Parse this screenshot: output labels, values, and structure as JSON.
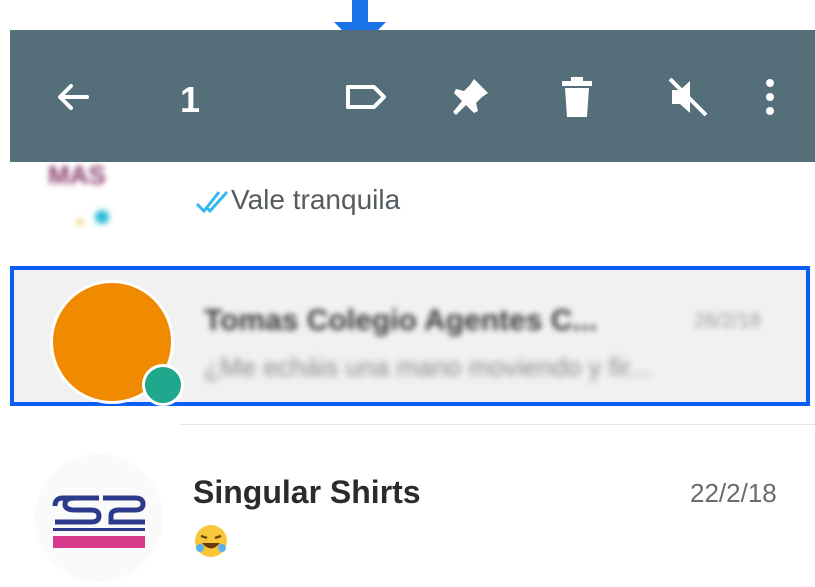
{
  "toolbar": {
    "selected_count": "1",
    "icons": [
      "back-arrow-icon",
      "label-icon",
      "pin-icon",
      "delete-icon",
      "mute-icon",
      "more-vert-icon"
    ]
  },
  "chats": [
    {
      "last_message": "Vale tranquila",
      "status": "double-check-read"
    },
    {
      "name": "Tomas Colegio Agentes C...",
      "date": "26/2/18",
      "last_message": "¿Me echáis una mano moviendo y fir...",
      "selected": true
    },
    {
      "name": "Singular Shirts",
      "date": "22/2/18",
      "last_message_icon": "laughing-emoji-icon"
    }
  ],
  "colors": {
    "toolbar": "#546e7a",
    "highlight": "#0a5ef0",
    "avatar": "#f08a00",
    "annotation_arrow": "#1a73e8"
  }
}
